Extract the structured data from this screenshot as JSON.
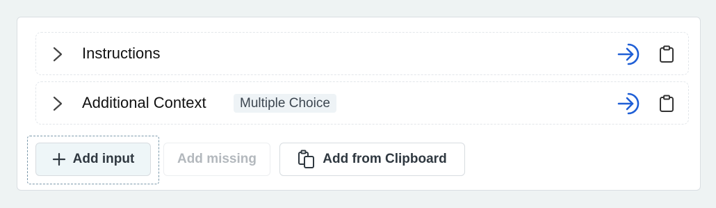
{
  "rows": [
    {
      "label": "Instructions",
      "tag": ""
    },
    {
      "label": "Additional Context",
      "tag": "Multiple Choice"
    }
  ],
  "actions": {
    "add_input": "Add input",
    "add_missing": "Add missing",
    "add_from_clipboard": "Add from Clipboard"
  },
  "colors": {
    "accent": "#1f5fd6",
    "background": "#eef3f3",
    "panel": "#ffffff"
  },
  "icons": {
    "expand": "chevron-right-icon",
    "insert": "arrow-into-icon",
    "clipboard": "clipboard-icon",
    "add": "plus-icon",
    "copy": "copy-icon"
  }
}
